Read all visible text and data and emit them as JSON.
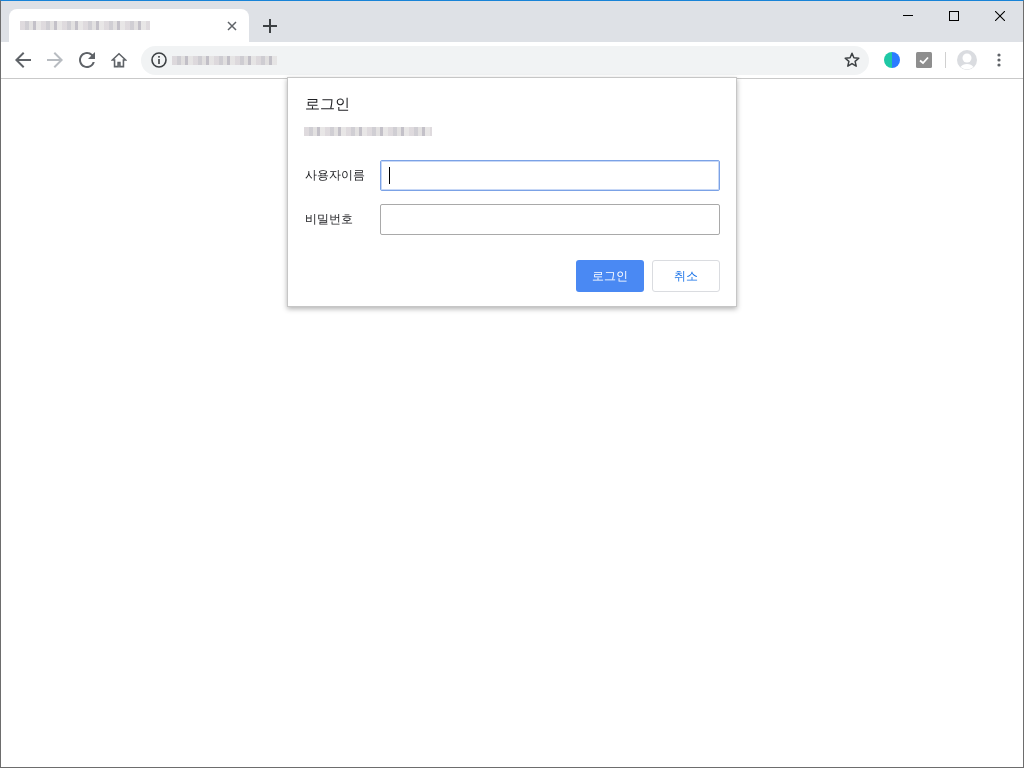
{
  "window": {
    "tabs": [
      {
        "selected": true
      }
    ]
  },
  "toolbar": {
    "nav": [
      {
        "kind": "back",
        "disabled": false
      },
      {
        "kind": "forward",
        "disabled": true
      },
      {
        "kind": "reload",
        "disabled": false
      },
      {
        "kind": "home",
        "disabled": false
      }
    ]
  },
  "dialog": {
    "title": "로그인",
    "fields": [
      {
        "label": "사용자이름",
        "focused": true
      },
      {
        "label": "비밀번호",
        "focused": false
      }
    ],
    "buttons": [
      {
        "label": "로그인",
        "kind": "primary"
      },
      {
        "label": "취소",
        "kind": "secondary"
      }
    ]
  }
}
